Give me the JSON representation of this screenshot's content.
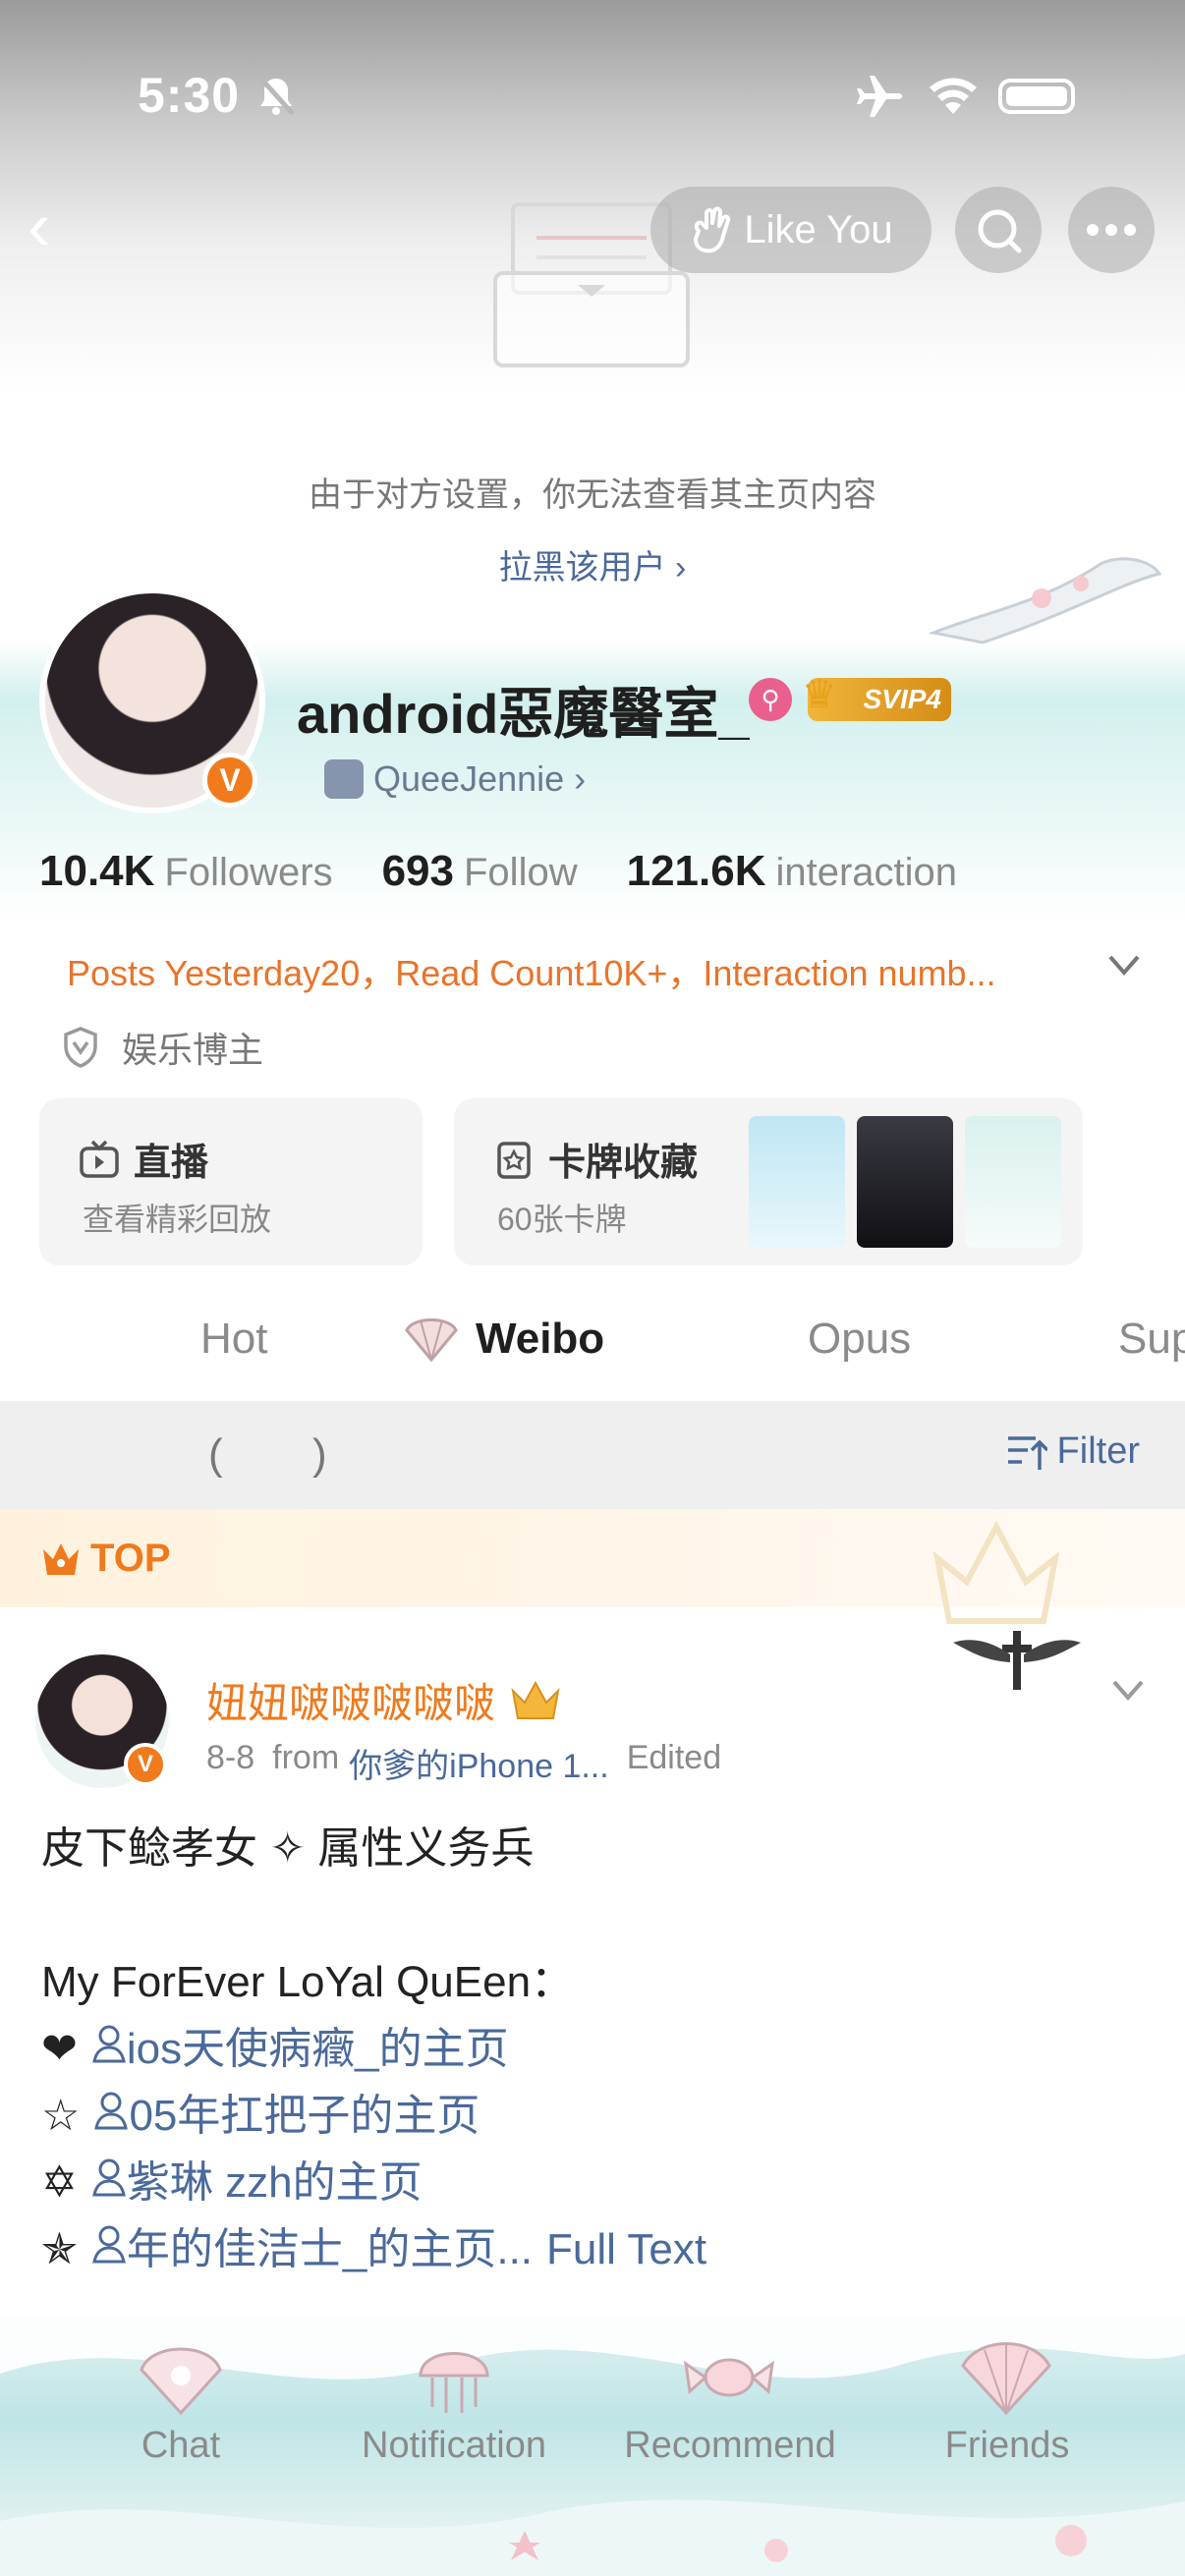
{
  "status_bar": {
    "time": "5:30"
  },
  "header": {
    "back_label": "‹",
    "like_label": "Like You"
  },
  "notice": {
    "hidden_text": "由于对方设置，你无法查看其主页内容",
    "block_link": "拉黑该用户 ›"
  },
  "profile": {
    "name": "android惡魔醫室_",
    "vip_label": "SVIP4",
    "verified_mark": "V",
    "fan_link": "QueeJennie",
    "fan_chevron": "›",
    "stats": {
      "followers_value": "10.4K",
      "followers_label": "Followers",
      "follow_value": "693",
      "follow_label": "Follow",
      "interaction_value": "121.6K",
      "interaction_label": "interaction"
    },
    "posts_summary": "Posts Yesterday20，Read Count10K+，Interaction numb...",
    "certification": "娱乐博主"
  },
  "cards": {
    "live_title": "直播",
    "live_sub": "查看精彩回放",
    "collection_title": "卡牌收藏",
    "collection_sub": "60张卡牌"
  },
  "tabs": [
    "Hot",
    "Weibo",
    "Opus",
    "Sup"
  ],
  "filter": {
    "label": "Filter",
    "paren_open": "(",
    "paren_close": ")"
  },
  "top_banner": {
    "label": "TOP"
  },
  "post": {
    "author": "妞妞啵啵啵啵啵",
    "date": "8-8",
    "from_label": "from",
    "source": "你爹的iPhone 1...",
    "edited": "Edited",
    "lines": {
      "l1": "皮下鲶孝女 ✧ 属性义务兵",
      "l2": "My ForEver LoYal QuEen：",
      "l3_mark": "❤",
      "l3_link": "ios天使病癥_的主页",
      "l4_mark": "☆",
      "l4_link": "05年扛把子的主页",
      "l5_mark": "✡",
      "l5_link": "紫琳 zzh的主页",
      "l6_mark": "✯",
      "l6_link": "年的佳洁士_的主页...",
      "l6_full": "Full Text"
    }
  },
  "bottom_nav": [
    "Chat",
    "Notification",
    "Recommend",
    "Friends"
  ],
  "colors": {
    "accent_orange": "#ef7a1d",
    "link_blue": "#4a6a9a",
    "vip_gold": "#e7a21c",
    "teal_theme": "#bfe5e6"
  }
}
